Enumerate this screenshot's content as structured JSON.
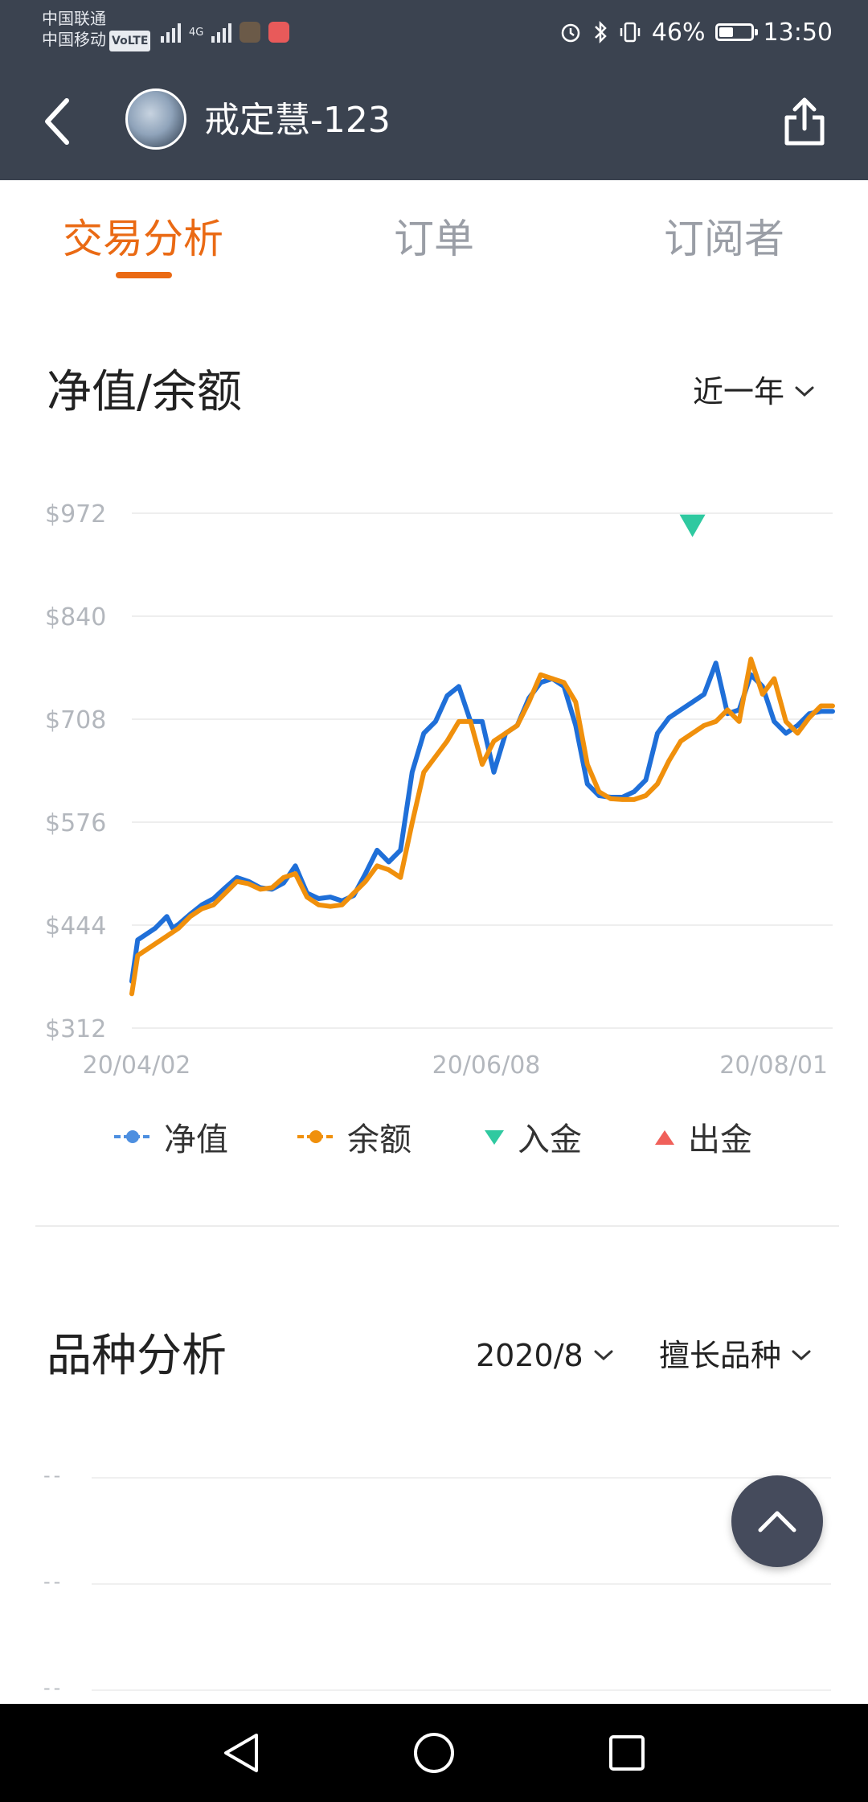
{
  "status_bar": {
    "carrier_1": "中国联通",
    "carrier_2": "中国移动",
    "volte": "VoLTE",
    "network_tag": "4G",
    "battery_percent": "46%",
    "battery_level": 0.46,
    "time": "13:50"
  },
  "app_bar": {
    "title": "戒定慧-123",
    "back_icon": "back-arrow-icon",
    "share_icon": "share-icon"
  },
  "tabs": [
    {
      "label": "交易分析",
      "active": true
    },
    {
      "label": "订单",
      "active": false
    },
    {
      "label": "订阅者",
      "active": false
    }
  ],
  "colors": {
    "accent": "#ea6a14",
    "header_bg": "#3b4350",
    "equity_line": "#1f6fd8",
    "balance_line": "#f0900c",
    "deposit_marker": "#2fc9a0",
    "withdraw_marker": "#f0605a"
  },
  "nav_section": {
    "title": "净值/余额",
    "range_label": "近一年"
  },
  "chart_data": {
    "type": "line",
    "ylabels": [
      "$972",
      "$840",
      "$708",
      "$576",
      "$444",
      "$312"
    ],
    "yticks": [
      972,
      840,
      708,
      576,
      444,
      312
    ],
    "ylim": [
      312,
      972
    ],
    "xlabels": [
      "20/04/02",
      "20/06/08",
      "20/08/01"
    ],
    "x_dates": [
      "2020-04-02",
      "2020-06-08",
      "2020-08-01"
    ],
    "grid": true,
    "legend_position": "bottom",
    "series": [
      {
        "name": "净值",
        "color": "#1f6fd8",
        "x": [
          0,
          1,
          2,
          4,
          6,
          7,
          8,
          10,
          12,
          14,
          16,
          18,
          20,
          22,
          24,
          26,
          28,
          30,
          32,
          34,
          36,
          38,
          40,
          42,
          44,
          46,
          48,
          50,
          52,
          54,
          56,
          58,
          60,
          62,
          64,
          66,
          68,
          70,
          72,
          74,
          76,
          78,
          80,
          82,
          84,
          86,
          88,
          90,
          92,
          94,
          96,
          98,
          100,
          102,
          104,
          106,
          108,
          110,
          112,
          114,
          116,
          118,
          120
        ],
        "values": [
          372,
          425,
          430,
          440,
          455,
          440,
          445,
          458,
          470,
          478,
          492,
          505,
          500,
          492,
          490,
          498,
          520,
          485,
          478,
          480,
          475,
          482,
          510,
          540,
          525,
          540,
          640,
          690,
          705,
          738,
          750,
          705,
          705,
          640,
          690,
          700,
          735,
          755,
          760,
          750,
          700,
          625,
          610,
          608,
          608,
          615,
          630,
          690,
          710,
          720,
          730,
          740,
          780,
          715,
          720,
          765,
          750,
          705,
          690,
          700,
          715,
          718,
          718
        ]
      },
      {
        "name": "余额",
        "color": "#f0900c",
        "x": [
          0,
          1,
          2,
          4,
          6,
          8,
          10,
          12,
          14,
          16,
          18,
          20,
          22,
          24,
          26,
          28,
          30,
          32,
          34,
          36,
          38,
          40,
          42,
          44,
          46,
          48,
          50,
          52,
          54,
          56,
          58,
          60,
          62,
          64,
          66,
          68,
          70,
          72,
          74,
          76,
          78,
          80,
          82,
          84,
          86,
          88,
          90,
          92,
          94,
          96,
          98,
          100,
          102,
          104,
          106,
          108,
          110,
          112,
          114,
          116,
          118,
          120
        ],
        "values": [
          356,
          405,
          410,
          420,
          430,
          440,
          455,
          465,
          470,
          485,
          500,
          497,
          490,
          492,
          505,
          510,
          480,
          470,
          468,
          470,
          485,
          500,
          520,
          515,
          505,
          575,
          640,
          660,
          680,
          705,
          705,
          650,
          680,
          690,
          700,
          730,
          765,
          760,
          755,
          730,
          650,
          615,
          606,
          605,
          605,
          610,
          625,
          655,
          680,
          690,
          700,
          705,
          720,
          705,
          785,
          740,
          760,
          705,
          690,
          710,
          725,
          725
        ]
      },
      {
        "name": "入金",
        "color": "#2fc9a0",
        "marker": "triangle-down",
        "x": [
          96
        ],
        "values": [
          958
        ]
      },
      {
        "name": "出金",
        "color": "#f0605a",
        "marker": "triangle-up",
        "x": [],
        "values": []
      }
    ]
  },
  "variety_section": {
    "title": "品种分析",
    "month_label": "2020/8",
    "type_label": "擅长品种",
    "placeholder": "--"
  }
}
